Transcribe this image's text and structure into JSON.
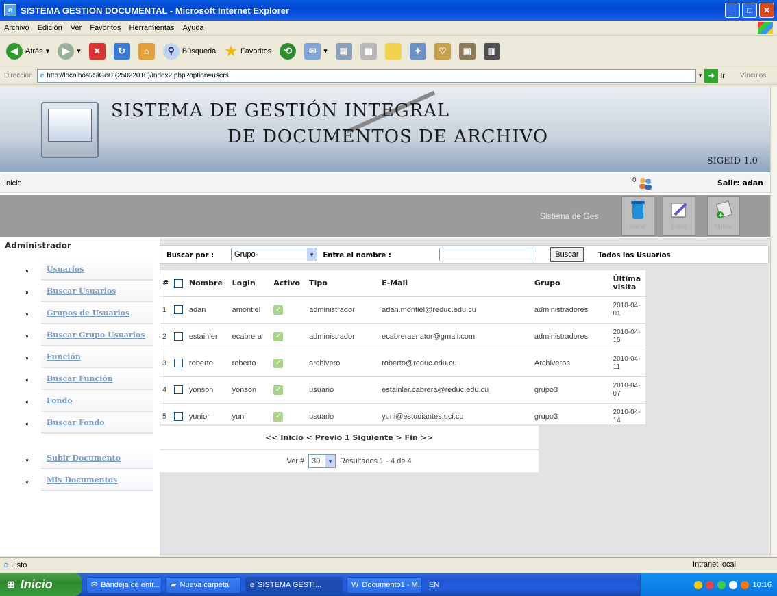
{
  "window": {
    "title": "SISTEMA GESTION DOCUMENTAL - Microsoft Internet Explorer"
  },
  "menubar": [
    "Archivo",
    "Edición",
    "Ver",
    "Favoritos",
    "Herramientas",
    "Ayuda"
  ],
  "toolbar": {
    "back": "Atrás",
    "search": "Búsqueda",
    "favorites": "Favoritos"
  },
  "address": {
    "label": "Dirección",
    "url": "http://localhost/SiGeDI(25022010)/index2.php?option=users",
    "go": "Ir",
    "links": "Vínculos"
  },
  "banner": {
    "line1": "SISTEMA DE GESTIÓN INTEGRAL",
    "line2": "DE DOCUMENTOS DE ARCHIVO",
    "version": "SIGEID 1.0"
  },
  "nav": {
    "home": "Inicio",
    "count": "0",
    "logout": "Salir: adan"
  },
  "actionbar": {
    "system_text": "Sistema de Ges",
    "delete": "Borrar",
    "edit": "Editar",
    "new": "Nuevo"
  },
  "sidebar": {
    "title": "Administrador",
    "items": [
      {
        "label": "Usuarios"
      },
      {
        "label": "Buscar Usuarios"
      },
      {
        "label": "Grupos de Usuarios"
      },
      {
        "label": "Buscar Grupo Usuarios"
      },
      {
        "label": "Función"
      },
      {
        "label": "Buscar Función"
      },
      {
        "label": "Fondo"
      },
      {
        "label": "Buscar Fondo"
      },
      {
        "label": "Subir Documento"
      },
      {
        "label": "Mis Documentos"
      }
    ]
  },
  "search": {
    "by_label": "Buscar por :",
    "by_value": "Grupo-",
    "name_label": "Entre el nombre :",
    "name_value": "",
    "button": "Buscar",
    "all_users": "Todos los Usuarios"
  },
  "table": {
    "headers": {
      "num": "#",
      "name": "Nombre",
      "login": "Login",
      "active": "Activo",
      "type": "Tipo",
      "email": "E-Mail",
      "group": "Grupo",
      "visit": "Última visita"
    },
    "rows": [
      {
        "num": "1",
        "name": "adan",
        "login": "amontiel",
        "type": "administrador",
        "email": "adan.montiel@reduc.edu.cu",
        "group": "administradores",
        "visit": "2010-04-01"
      },
      {
        "num": "2",
        "name": "estainler",
        "login": "ecabrera",
        "type": "administrador",
        "email": "ecabreraenator@gmail.com",
        "group": "administradores",
        "visit": "2010-04-15"
      },
      {
        "num": "3",
        "name": "roberto",
        "login": "roberto",
        "type": "archivero",
        "email": "roberto@reduc.edu.cu",
        "group": "Archiveros",
        "visit": "2010-04-11"
      },
      {
        "num": "4",
        "name": "yonson",
        "login": "yonson",
        "type": "usuario",
        "email": "estainler.cabrera@reduc.edu.cu",
        "group": "grupo3",
        "visit": "2010-04-07"
      },
      {
        "num": "5",
        "name": "yunior",
        "login": "yuni",
        "type": "usuario",
        "email": "yuni@estudiantes.uci.cu",
        "group": "grupo3",
        "visit": "2010-04-14"
      }
    ]
  },
  "pager": {
    "text": "<< Inicio < Previo 1 Siguiente > Fin >>",
    "ver_label": "Ver #",
    "per_page": "30",
    "results": "Resultados 1 - 4 de 4"
  },
  "status": {
    "left": "Listo",
    "zone": "Intranet local"
  },
  "taskbar": {
    "start": "Inicio",
    "tasks": [
      "Bandeja de entr...",
      "Nueva carpeta",
      "SISTEMA GESTI...",
      "Documento1 - M..."
    ],
    "lang": "EN",
    "clock": "10:16"
  }
}
